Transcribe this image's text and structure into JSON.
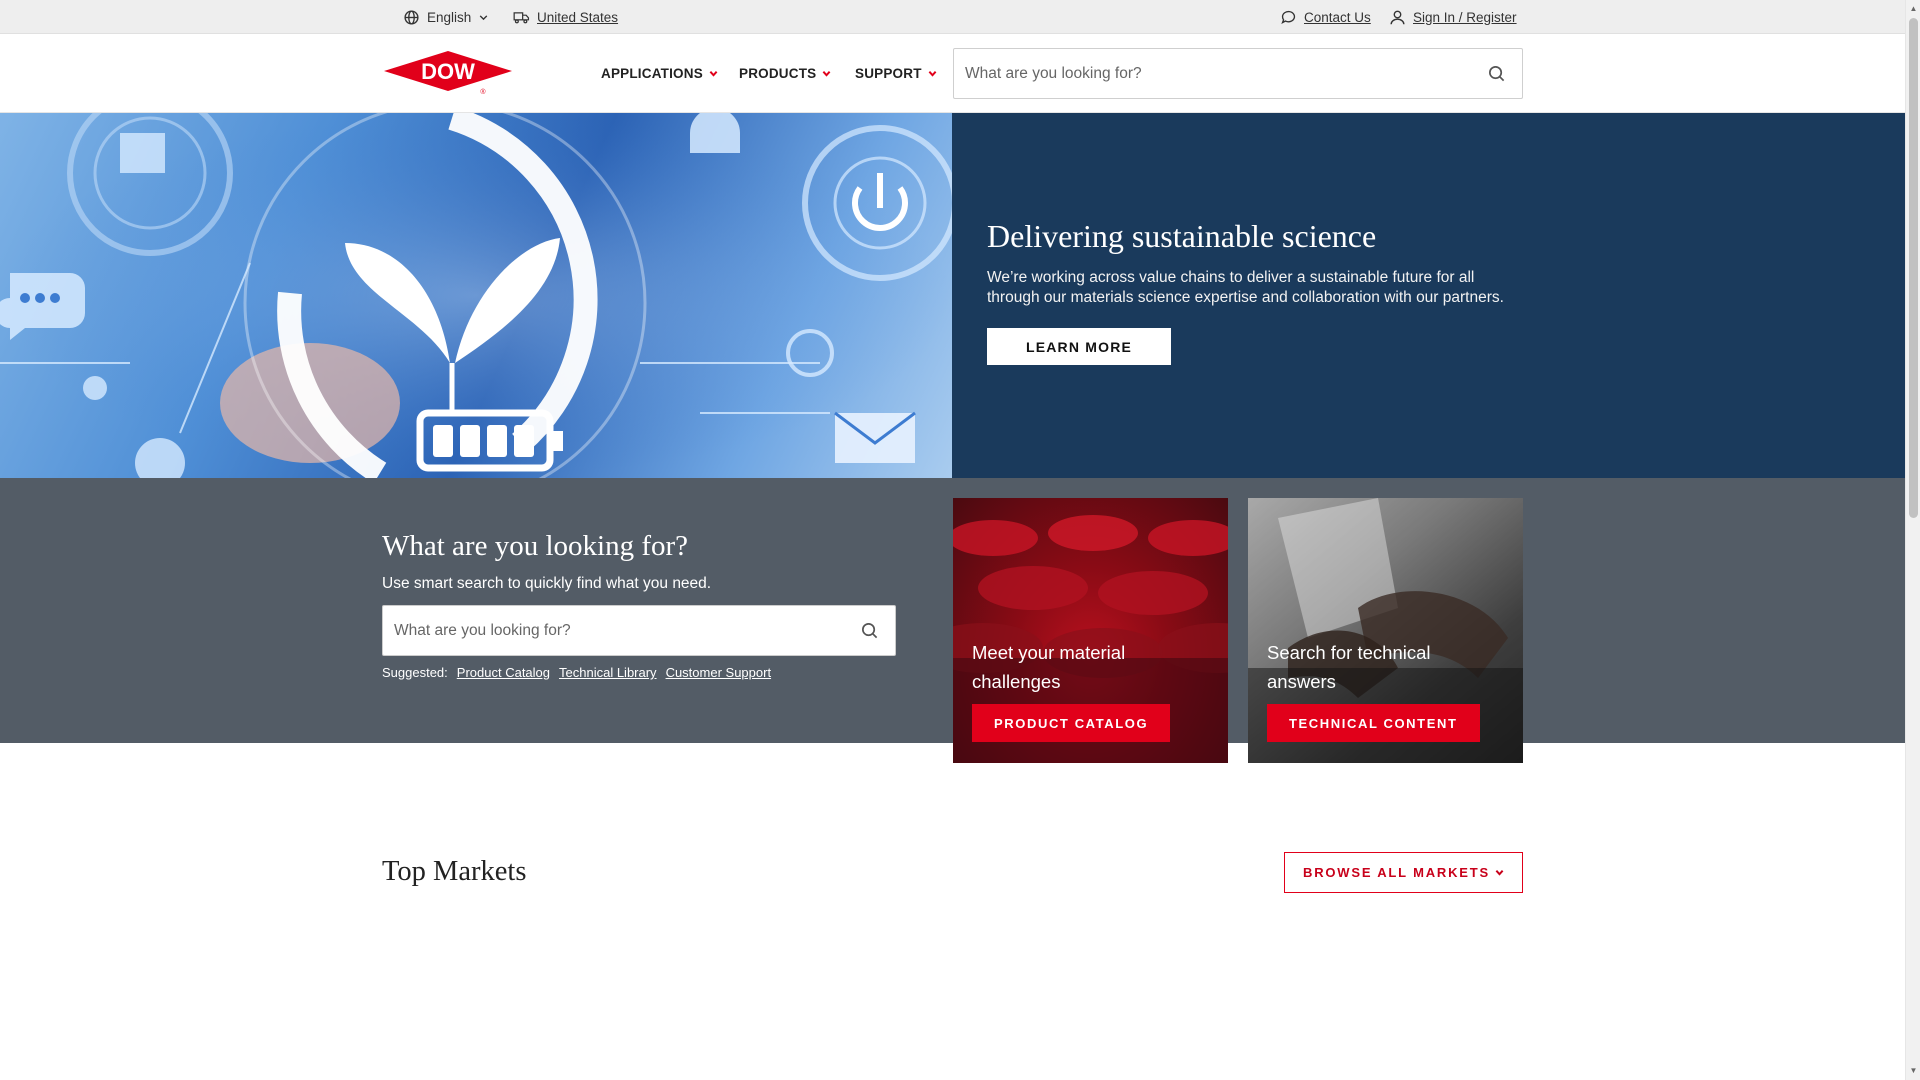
{
  "utility": {
    "language": "English",
    "country": "United States",
    "contact": "Contact Us",
    "signin": "Sign In / Register"
  },
  "header": {
    "logo_text": "DOW",
    "nav": [
      "APPLICATIONS",
      "PRODUCTS",
      "SUPPORT"
    ],
    "search_placeholder": "What are you looking for?"
  },
  "hero": {
    "title": "Delivering sustainable science",
    "description": "We’re working across value chains to deliver a sustainable future for all through our materials science expertise and collaboration with our partners.",
    "button": "LEARN MORE"
  },
  "band": {
    "title": "What are you looking for?",
    "subtitle": "Use smart search to quickly find what you need.",
    "search_placeholder": "What are you looking for?",
    "suggested_label": "Suggested:",
    "suggested": [
      "Product Catalog",
      "Technical Library",
      "Customer Support"
    ]
  },
  "cards": [
    {
      "text": "Meet your material challenges",
      "button": "PRODUCT CATALOG"
    },
    {
      "text": "Search for technical answers",
      "button": "TECHNICAL CONTENT"
    }
  ],
  "markets": {
    "title": "Top Markets",
    "button": "BROWSE ALL MARKETS"
  },
  "colors": {
    "brand_red": "#e1001a",
    "hero_bg": "#1a3a5c",
    "band_bg": "#535c66"
  }
}
